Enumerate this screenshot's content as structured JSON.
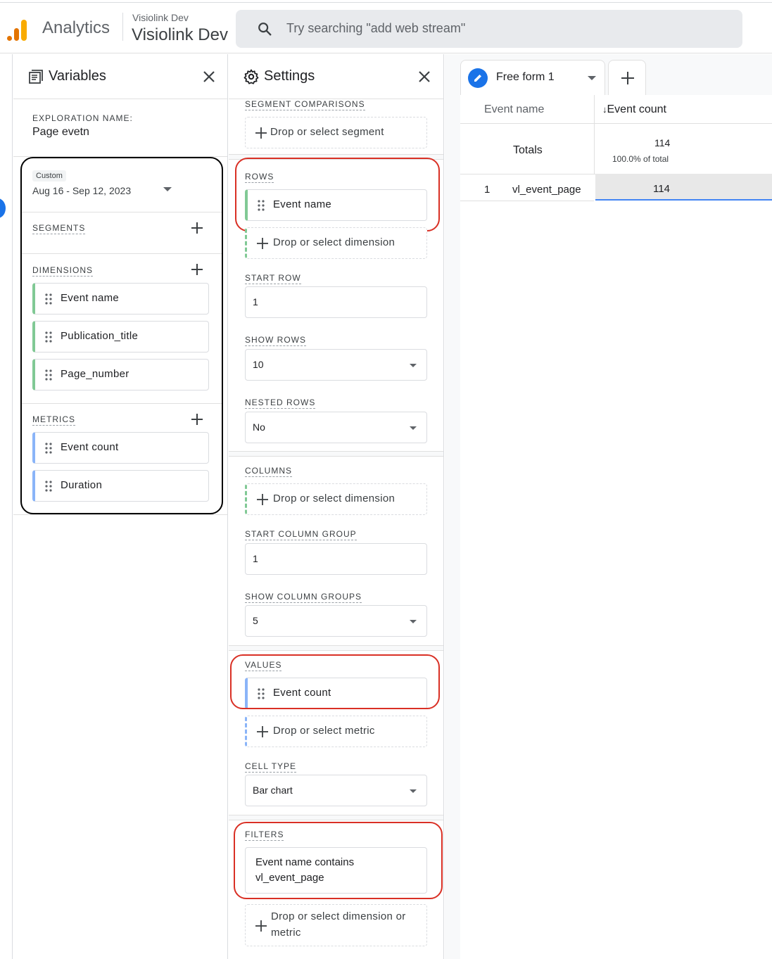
{
  "header": {
    "app_name": "Analytics",
    "account_small": "Visiolink Dev",
    "account_big": "Visiolink Dev",
    "search_placeholder": "Try searching \"add web stream\""
  },
  "variables": {
    "title": "Variables",
    "exploration_label": "EXPLORATION NAME:",
    "exploration_name": "Page evetn",
    "date_chip": "Custom",
    "date_range": "Aug 16 - Sep 12, 2023",
    "segments_label": "SEGMENTS",
    "dimensions_label": "DIMENSIONS",
    "dimensions": [
      "Event name",
      "Publication_title",
      "Page_number"
    ],
    "metrics_label": "METRICS",
    "metrics": [
      "Event count",
      "Duration"
    ]
  },
  "settings": {
    "title": "Settings",
    "segment_comparisons_label": "SEGMENT COMPARISONS",
    "segment_drop": "Drop or select segment",
    "rows_label": "ROWS",
    "rows_item": "Event name",
    "rows_drop": "Drop or select dimension",
    "start_row_label": "START ROW",
    "start_row": "1",
    "show_rows_label": "SHOW ROWS",
    "show_rows": "10",
    "nested_rows_label": "NESTED ROWS",
    "nested_rows": "No",
    "columns_label": "COLUMNS",
    "columns_drop": "Drop or select dimension",
    "start_col_label": "START COLUMN GROUP",
    "start_col": "1",
    "show_col_label": "SHOW COLUMN GROUPS",
    "show_col": "5",
    "values_label": "VALUES",
    "values_item": "Event count",
    "values_drop": "Drop or select metric",
    "cell_type_label": "CELL TYPE",
    "cell_type": "Bar chart",
    "filters_label": "FILTERS",
    "filter_line1": "Event name contains",
    "filter_line2": "vl_event_page",
    "filters_drop_line1": "Drop or select dimension or",
    "filters_drop_line2": "metric"
  },
  "canvas": {
    "tab_label": "Free form 1",
    "table": {
      "dim_header": "Event name",
      "metric_header": "Event count",
      "sort_arrow": "↓",
      "totals_label": "Totals",
      "totals_value": "114",
      "totals_pct": "100.0% of total",
      "rows": [
        {
          "index": "1",
          "name": "vl_event_page",
          "value": "114"
        }
      ]
    }
  },
  "colors": {
    "accent": "#1a73e8",
    "dimension_accent": "#81c995",
    "metric_accent": "#8ab4f8",
    "highlight_red": "#d93025",
    "logo_orange": "#e37400",
    "logo_yellow": "#f9ab00"
  }
}
